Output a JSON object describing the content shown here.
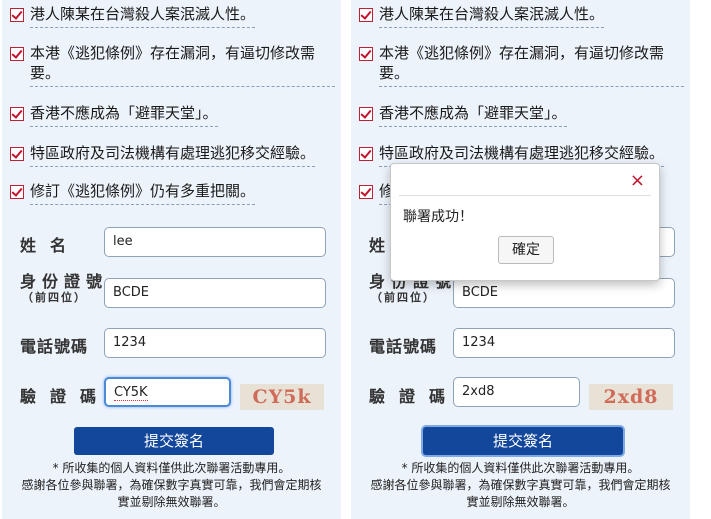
{
  "checklist": [
    "港人陳某在台灣殺人案泯滅人性。",
    "本港《逃犯條例》存在漏洞，有逼切修改需要。",
    "香港不應成為「避罪天堂」。",
    "特區政府及司法機構有處理逃犯移交經驗。",
    "修訂《逃犯條例》仍有多重把關。"
  ],
  "form": {
    "name_label": "姓名",
    "id_label": "身份證號",
    "id_sublabel": "（前四位）",
    "phone_label": "電話號碼",
    "captcha_label": "驗證碼"
  },
  "left": {
    "name_value": "lee",
    "id_value": "BCDE",
    "phone_value": "1234",
    "captcha_value": "CY5K",
    "captcha_image_text": "CY5k"
  },
  "right": {
    "name_value": "",
    "id_value": "BCDE",
    "phone_value": "1234",
    "captcha_value": "2xd8",
    "captcha_image_text": "2xd8"
  },
  "submit_label": "提交簽名",
  "footer": {
    "line1": "* 所收集的個人資料僅供此次聯署活動專用。",
    "line2": "感謝各位參與聯署，為確保數字真實可靠，我們會定期核",
    "line3": "實並剔除無效聯署。"
  },
  "modal": {
    "close_glyph": "×",
    "message": "聯署成功！",
    "ok_label": "確定"
  },
  "colors": {
    "panel_bg": "#edf3fb",
    "submit_bg": "#13479b",
    "check_red": "#c3122a"
  }
}
